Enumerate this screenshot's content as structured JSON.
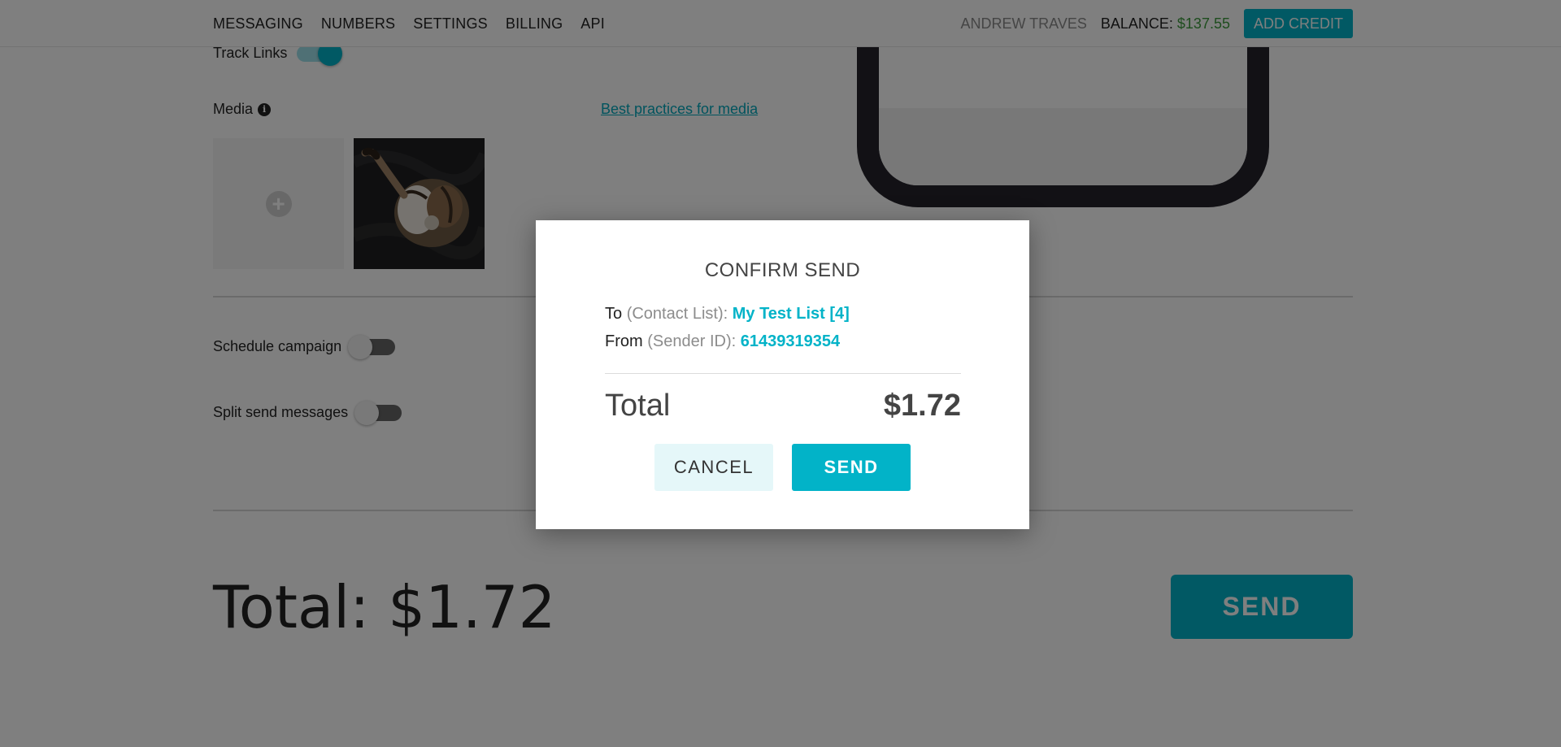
{
  "nav": {
    "items": [
      {
        "label": "MESSAGING"
      },
      {
        "label": "NUMBERS"
      },
      {
        "label": "SETTINGS"
      },
      {
        "label": "BILLING"
      },
      {
        "label": "API"
      }
    ],
    "user_name": "ANDREW TRAVES",
    "balance_label": "BALANCE: ",
    "balance_amount": "$137.55",
    "add_credit_label": "ADD CREDIT"
  },
  "form": {
    "track_links_label": "Track Links",
    "track_links_on": true,
    "media_label": "Media",
    "best_practices_link": "Best practices for media",
    "schedule_label": "Schedule campaign",
    "schedule_on": false,
    "split_send_label": "Split send messages",
    "split_send_on": false,
    "total_label": "Total: $",
    "total_amount": "1.72",
    "send_label": "SEND"
  },
  "modal": {
    "title": "CONFIRM SEND",
    "to_label": "To",
    "to_hint": "(Contact List):",
    "to_value": "My Test List [4]",
    "from_label": "From",
    "from_hint": "(Sender ID):",
    "from_value": "61439319354",
    "total_label": "Total",
    "total_value": "$1.72",
    "cancel_label": "CANCEL",
    "send_label": "SEND"
  },
  "icons": {
    "info": "info-icon",
    "add_media": "plus-circle-icon"
  },
  "colors": {
    "accent": "#02b3c8",
    "balance_green": "#3d9a3d",
    "phone_frame": "#24232b"
  }
}
